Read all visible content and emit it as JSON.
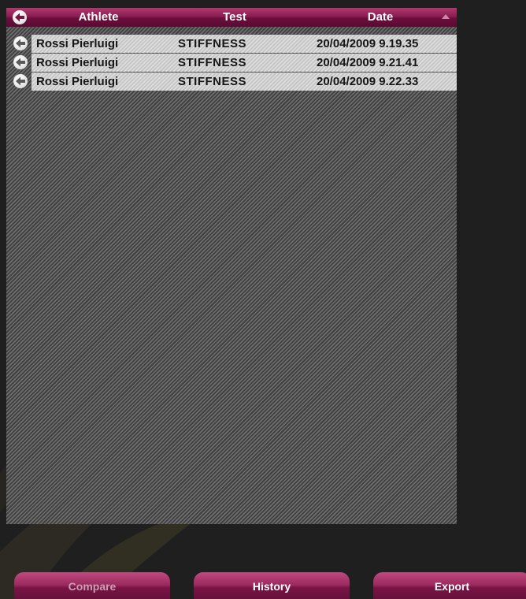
{
  "table": {
    "columns": {
      "athlete": "Athlete",
      "test": "Test",
      "date": "Date"
    },
    "sort": {
      "column": "date",
      "direction": "ascending"
    },
    "rows": [
      {
        "athlete": "Rossi Pierluigi",
        "test": "STIFFNESS",
        "date": "20/04/2009 9.19.35"
      },
      {
        "athlete": "Rossi Pierluigi",
        "test": "STIFFNESS",
        "date": "20/04/2009 9.21.41"
      },
      {
        "athlete": "Rossi Pierluigi",
        "test": "STIFFNESS",
        "date": "20/04/2009 9.22.33"
      }
    ]
  },
  "buttons": {
    "compare": {
      "label": "Compare",
      "enabled": false
    },
    "history": {
      "label": "History",
      "enabled": true
    },
    "export": {
      "label": "Export",
      "enabled": true
    }
  },
  "icons": {
    "header_back": "back-arrow-icon",
    "row_back": "back-arrow-icon",
    "sort": "sort-ascending-icon"
  },
  "colors": {
    "accent": "#8a1d52",
    "background": "#1f1f1f",
    "row_background": "#cfcfcf"
  }
}
